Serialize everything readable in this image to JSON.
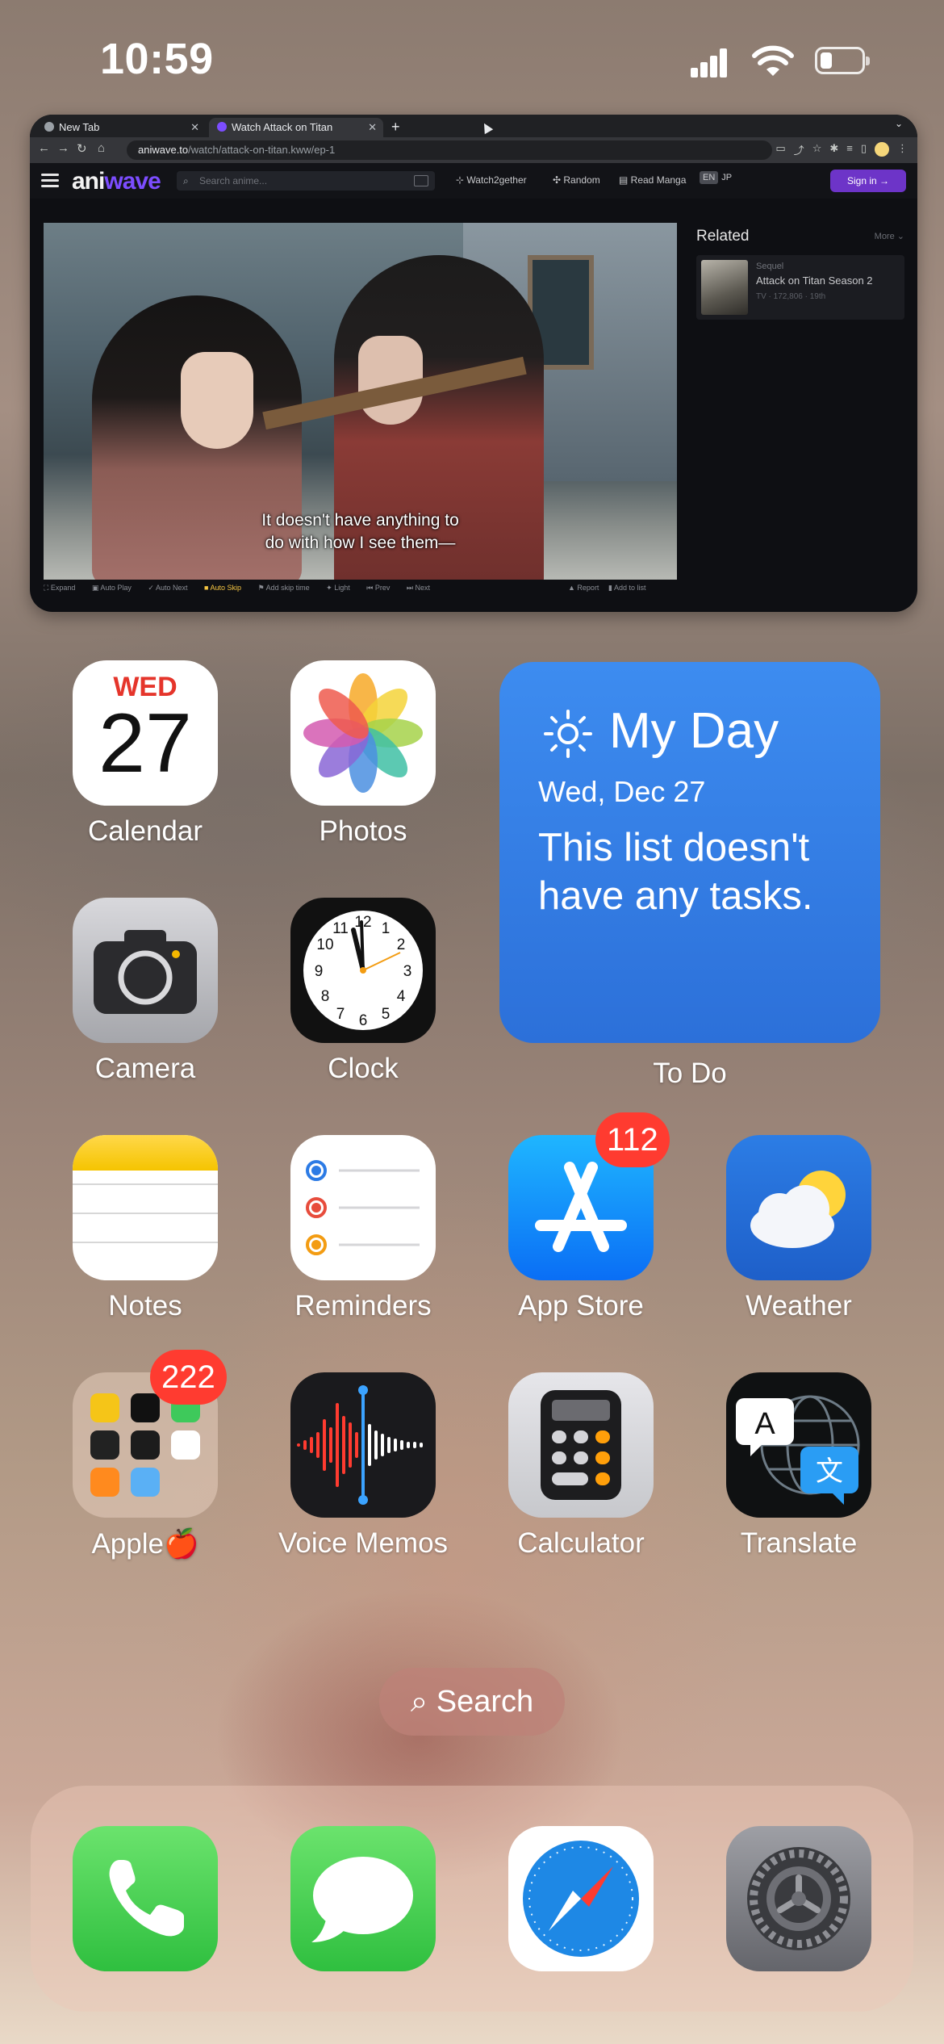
{
  "status": {
    "time": "10:59"
  },
  "browser": {
    "tabs": [
      {
        "label": "New Tab",
        "close": "✕"
      },
      {
        "label": "Watch Attack on Titan",
        "close": "✕"
      }
    ],
    "new_tab": "+",
    "url_host": "aniwave.to",
    "url_path": "/watch/attack-on-titan.kww/ep-1",
    "site": {
      "logo_main": "ani",
      "logo_accent": "wave",
      "search_placeholder": "Search anime...",
      "nav": [
        "Watch2gether",
        "Random",
        "Read Manga"
      ],
      "lang_en": "EN",
      "lang_jp": "JP",
      "signin": "Sign in →"
    },
    "player": {
      "subtitle_line1": "It doesn't have anything to",
      "subtitle_line2": "do with how I see them—",
      "controls": [
        "Expand",
        "Auto Play",
        "Auto Next",
        "Auto Skip",
        "Add skip time",
        "Light",
        "Prev",
        "Next"
      ],
      "controls_right": [
        "Report",
        "Add to list"
      ]
    },
    "related": {
      "heading": "Related",
      "more": "More",
      "item": {
        "tag": "Sequel",
        "title": "Attack on Titan Season 2",
        "meta": "TV · 172,806 · 19th"
      }
    }
  },
  "home": {
    "apps": [
      {
        "id": "calendar",
        "label": "Calendar",
        "dow": "WED",
        "day": "27"
      },
      {
        "id": "photos",
        "label": "Photos"
      },
      {
        "id": "camera",
        "label": "Camera"
      },
      {
        "id": "clock",
        "label": "Clock"
      },
      {
        "id": "notes",
        "label": "Notes"
      },
      {
        "id": "reminders",
        "label": "Reminders"
      },
      {
        "id": "appstore",
        "label": "App Store",
        "badge": "112"
      },
      {
        "id": "weather",
        "label": "Weather"
      },
      {
        "id": "applefolder",
        "label": "Apple🍎",
        "badge": "222"
      },
      {
        "id": "voicememos",
        "label": "Voice Memos"
      },
      {
        "id": "calculator",
        "label": "Calculator"
      },
      {
        "id": "translate",
        "label": "Translate"
      }
    ],
    "todo_widget": {
      "title": "My Day",
      "date": "Wed, Dec 27",
      "message": "This list doesn't have any tasks.",
      "label": "To Do"
    },
    "search": "Search",
    "dock": [
      "phone-icon",
      "messages-icon",
      "safari-icon",
      "settings-icon"
    ]
  },
  "colors": {
    "todo_blue": "#3d8cf0",
    "badge_red": "#ff3b30",
    "accent_purple": "#6d34c8"
  }
}
